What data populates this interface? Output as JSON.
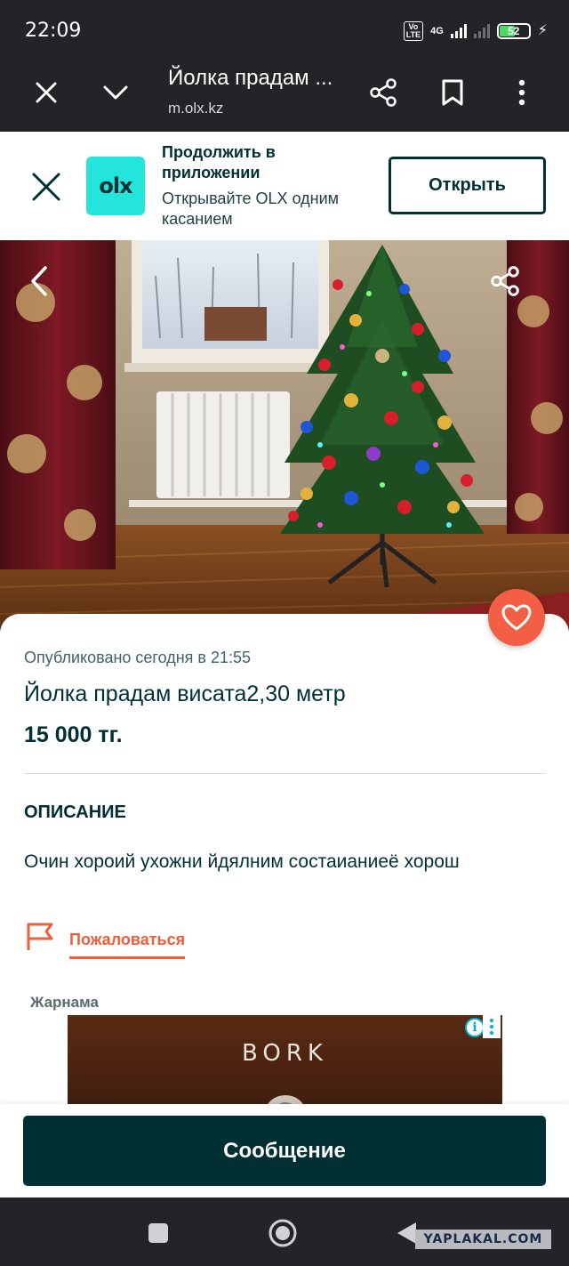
{
  "status_bar": {
    "time": "22:09",
    "volte": "Vo LTE",
    "network": "4G",
    "battery": "52"
  },
  "browser": {
    "page_title": "Йолка прадам ...",
    "url": "m.olx.kz"
  },
  "app_banner": {
    "logo_text": "olx",
    "title": "Продолжить в приложении",
    "subtitle": "Открывайте OLX одним касанием",
    "open_button": "Открыть"
  },
  "listing": {
    "published": "Опубликовано сегодня в 21:55",
    "title": "Йолка прадам висата2,30 метр",
    "price": "15 000 тг.",
    "description_heading": "ОПИСАНИЕ",
    "description": "Очин хороий ухожни йдялним состаианиеё хорош",
    "report_label": "Пожаловаться"
  },
  "advertising": {
    "label": "Жарнама",
    "brand": "BORK"
  },
  "message_button": "Сообщение",
  "watermark": "YAPLAKAL.COM",
  "colors": {
    "olx_teal": "#23e5db",
    "olx_dark": "#002f34",
    "accent_orange": "#f05d3b",
    "favorite_button": "#f25f44"
  },
  "icons": {
    "browser_close": "close-icon",
    "browser_collapse": "chevron-down-icon",
    "browser_share": "share-icon",
    "browser_bookmark": "bookmark-icon",
    "browser_menu": "more-vertical-icon",
    "banner_close": "close-icon",
    "photo_back": "chevron-left-icon",
    "photo_share": "share-icon",
    "favorite": "heart-icon",
    "report": "flag-icon",
    "nav_recents": "square-icon",
    "nav_home": "circle-icon",
    "nav_back": "triangle-back-icon"
  }
}
